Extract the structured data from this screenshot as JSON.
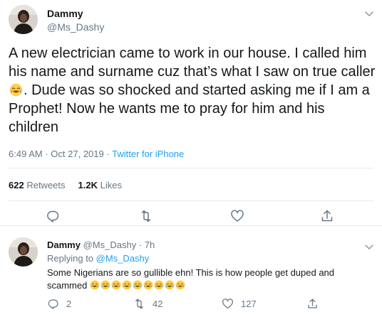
{
  "main_tweet": {
    "author_name": "Dammy",
    "author_handle": "@Ms_Dashy",
    "text_part1": "A new electrician came to work in our house. I called him his name and surname cuz that’s what I saw on true caller",
    "text_emoji": "😂",
    "text_part2": ". Dude was so shocked and started asking me if I am a Prophet! Now he wants me to pray for him and his children",
    "time": "6:49 AM",
    "date": "Oct 27, 2019",
    "separator": "·",
    "source": "Twitter for iPhone",
    "retweets_count": "622",
    "retweets_label": "Retweets",
    "likes_count": "1.2K",
    "likes_label": "Likes"
  },
  "reply_tweet": {
    "author_name": "Dammy",
    "author_handle": "@Ms_Dashy",
    "separator": "·",
    "age": "7h",
    "replying_label": "Replying to",
    "replying_to": "@Ms_Dashy",
    "text": "Some Nigerians are so gullible ehn! This is how people get duped and scammed",
    "emoji_count": 9,
    "replies": "2",
    "retweets": "42",
    "likes": "127"
  },
  "colors": {
    "text": "#14171a",
    "secondary": "#657786",
    "link": "#1da1f2",
    "divider": "#e6ecf0"
  },
  "icons": {
    "reply": "reply-icon",
    "retweet": "retweet-icon",
    "like": "heart-icon",
    "share": "share-icon",
    "more": "chevron-down-icon",
    "emoji": "face-with-tears-of-joy-emoji"
  }
}
